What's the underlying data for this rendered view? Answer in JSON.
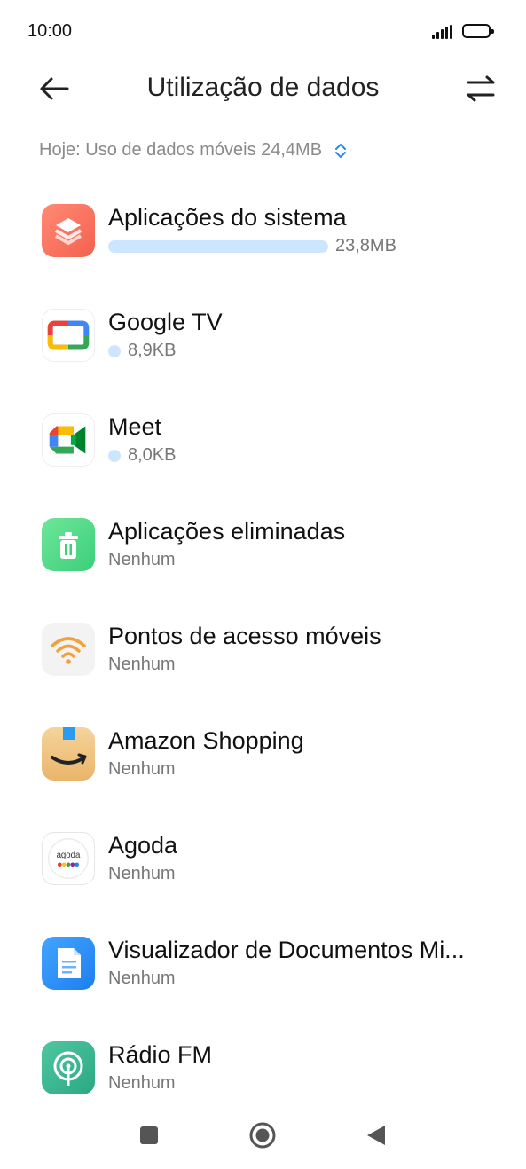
{
  "status_bar": {
    "time": "10:00"
  },
  "header": {
    "title": "Utilização de dados"
  },
  "summary": {
    "text": "Hoje: Uso de dados móveis 24,4MB"
  },
  "apps": [
    {
      "name": "Aplicações do sistema",
      "usage": "23,8MB",
      "icon": "layers-icon",
      "usage_fraction": 1.0
    },
    {
      "name": "Google TV",
      "usage": "8,9KB",
      "icon": "google-tv-icon"
    },
    {
      "name": "Meet",
      "usage": "8,0KB",
      "icon": "meet-icon"
    },
    {
      "name": "Aplicações eliminadas",
      "usage": "Nenhum",
      "icon": "trash-icon"
    },
    {
      "name": "Pontos de acesso móveis",
      "usage": "Nenhum",
      "icon": "wifi-icon"
    },
    {
      "name": "Amazon Shopping",
      "usage": "Nenhum",
      "icon": "amazon-icon"
    },
    {
      "name": "Agoda",
      "usage": "Nenhum",
      "icon": "agoda-icon"
    },
    {
      "name": "Visualizador de Documentos Mi...",
      "usage": "Nenhum",
      "icon": "document-icon"
    },
    {
      "name": "Rádio FM",
      "usage": "Nenhum",
      "icon": "radio-icon"
    }
  ],
  "colors": {
    "usage_bar": "#cde6ff",
    "summary_text": "#8a8a8a",
    "accent": "#1e88ff"
  }
}
